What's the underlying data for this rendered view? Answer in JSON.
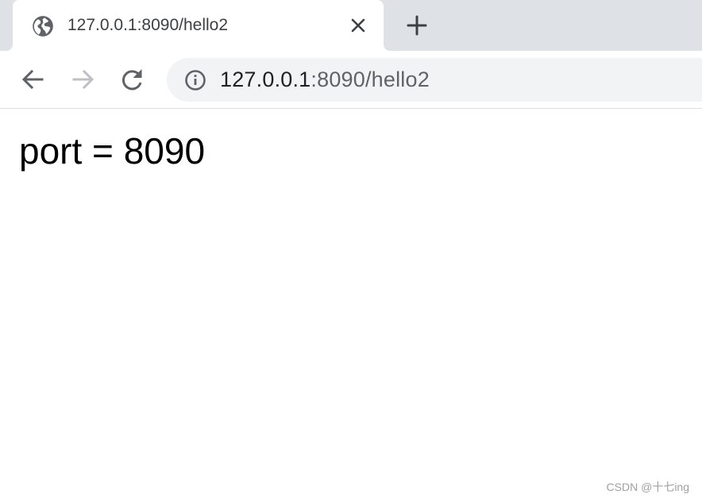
{
  "tab": {
    "title": "127.0.0.1:8090/hello2",
    "favicon": "globe-icon",
    "close_icon": "close-icon"
  },
  "new_tab_icon": "plus-icon",
  "toolbar": {
    "back_icon": "back-arrow-icon",
    "forward_icon": "forward-arrow-icon",
    "reload_icon": "reload-icon",
    "info_icon": "info-icon"
  },
  "address_bar": {
    "host": "127.0.0.1",
    "path": ":8090/hello2"
  },
  "page": {
    "text": "port = 8090"
  },
  "watermark": "CSDN @十七ing",
  "colors": {
    "tab_strip": "#dee1e6",
    "omnibox": "#f1f3f4",
    "icon": "#5f6368",
    "icon_disabled": "#bdc1c6"
  }
}
